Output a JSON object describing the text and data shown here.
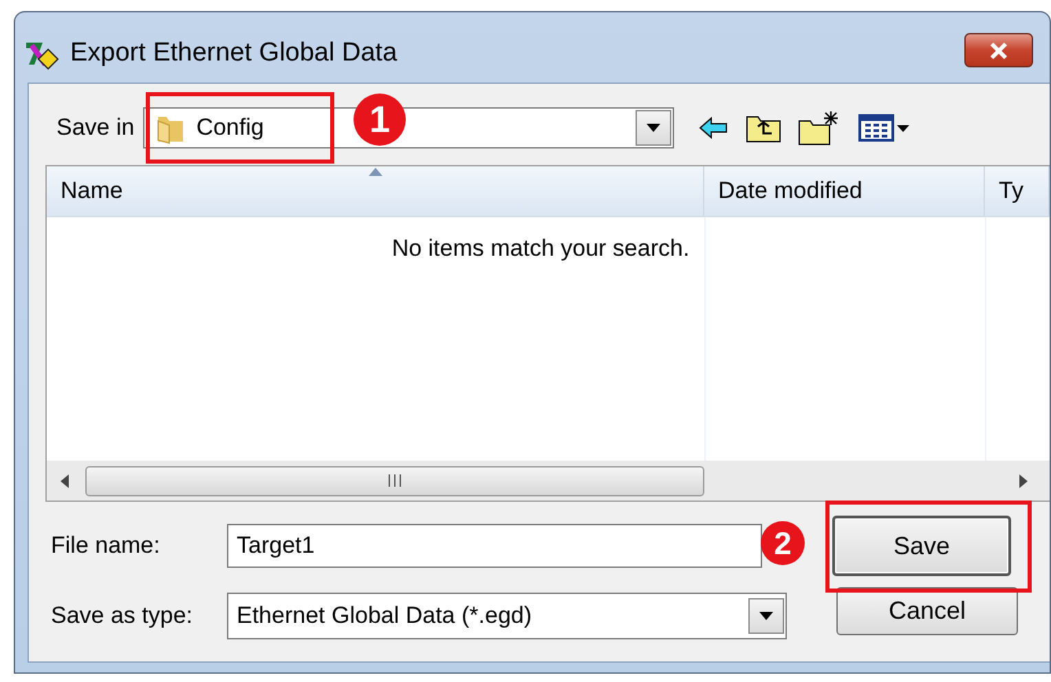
{
  "window": {
    "title": "Export Ethernet Global Data"
  },
  "save_in": {
    "label": "Save in",
    "value": "Config"
  },
  "file_list": {
    "columns": [
      {
        "label": "Name",
        "sorted": true
      },
      {
        "label": "Date modified",
        "sorted": false
      },
      {
        "label": "Ty",
        "sorted": false
      }
    ],
    "empty_message": "No items match your search."
  },
  "file_name": {
    "label": "File name:",
    "value": "Target1"
  },
  "save_as_type": {
    "label": "Save as type:",
    "value": "Ethernet Global Data (*.egd)"
  },
  "buttons": [
    {
      "label": "Save",
      "kind": "default"
    },
    {
      "label": "Cancel",
      "kind": "normal"
    }
  ],
  "callouts": [
    {
      "number": "1"
    },
    {
      "number": "2"
    }
  ]
}
